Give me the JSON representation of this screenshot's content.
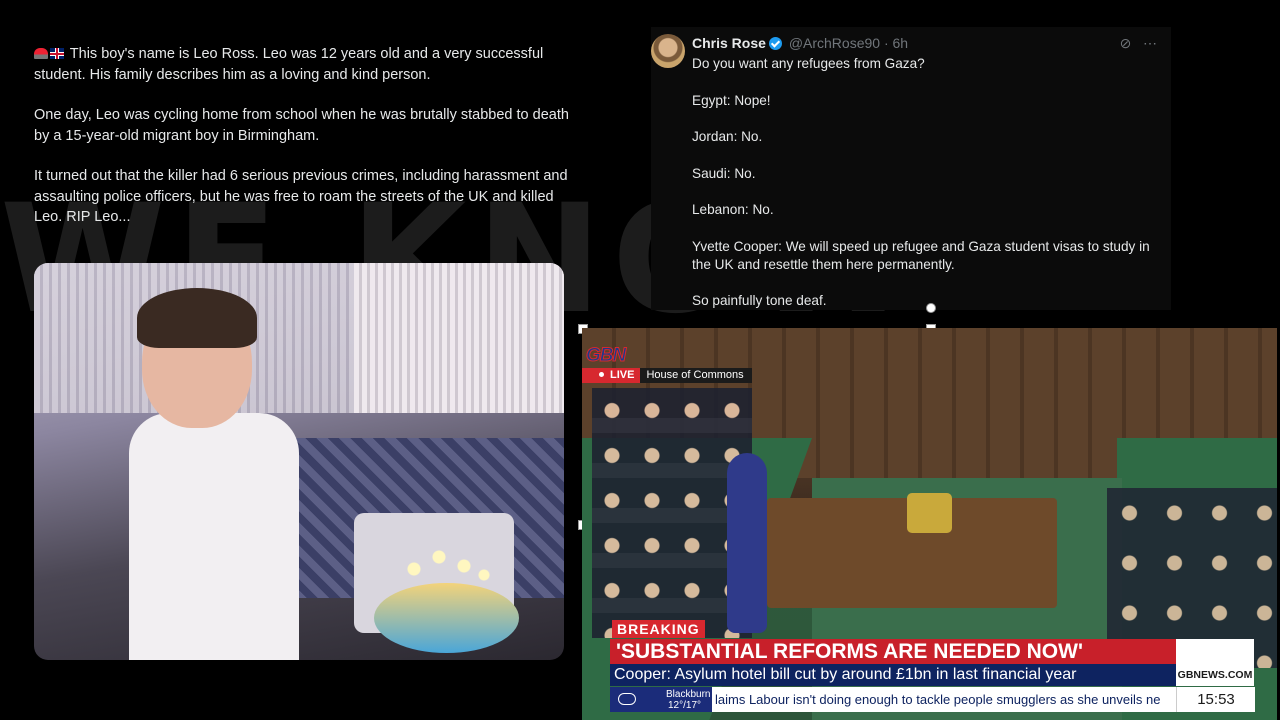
{
  "left_post": {
    "paragraphs": [
      "This boy's name is Leo Ross. Leo was 12 years old and a very successful student. His family describes him as a loving and kind person.",
      "One day, Leo was cycling home from school when he was brutally stabbed to death by a 15-year-old migrant boy in Birmingham.",
      "It turned out that the killer had 6 serious previous crimes, including harassment and assaulting police officers, but he was free to roam the streets of the UK and killed Leo. RIP Leo..."
    ],
    "lead_icons": [
      "siren-icon",
      "uk-flag-icon"
    ]
  },
  "tweet": {
    "name": "Chris Rose",
    "handle": "@ArchRose90 · 6h",
    "lines": [
      "Do you want any refugees from Gaza?",
      "Egypt: Nope!",
      "Jordan: No.",
      "Saudi: No.",
      "Lebanon: No.",
      "Yvette Cooper: We will speed up refugee and Gaza student visas to study in the UK and resettle them here permanently.",
      "So painfully tone deaf."
    ],
    "icons": [
      "grok-icon",
      "more-icon"
    ]
  },
  "news": {
    "channel_logo": "GBN",
    "live_label": "LIVE",
    "location": "House of Commons",
    "breaking_label": "BREAKING",
    "headline": "'SUBSTANTIAL REFORMS ARE NEEDED NOW'",
    "subheadline": "Cooper: Asylum hotel bill cut by around £1bn in last financial year",
    "ticker": "laims Labour isn't doing enough to tackle people smugglers as she unveils ne",
    "weather_city": "Blackburn",
    "weather_temp": "12°/17°",
    "website": "GBNEWS.COM",
    "time": "15:53"
  },
  "background_text": "WE KNOW"
}
